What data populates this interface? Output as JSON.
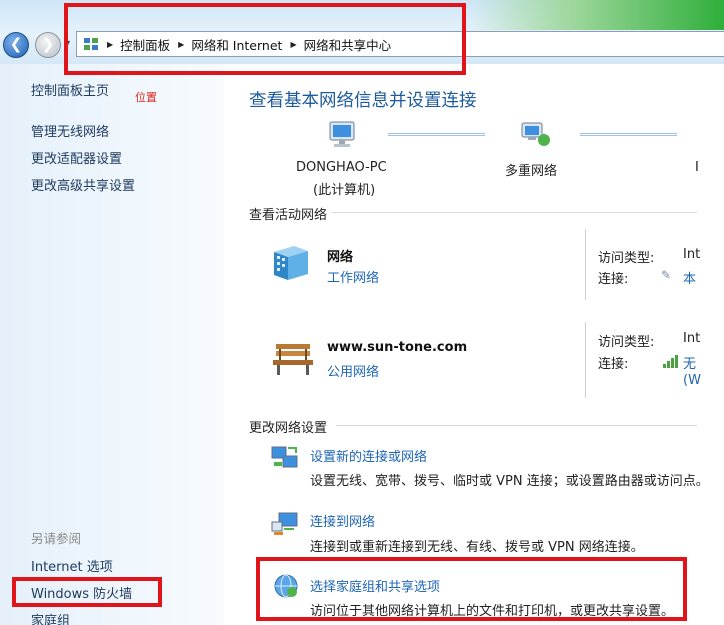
{
  "address_bar": {
    "crumbs": [
      "控制面板",
      "网络和 Internet",
      "网络和共享中心"
    ]
  },
  "left_pane": {
    "home": "控制面板主页",
    "location_note": "位置",
    "links": [
      "管理无线网络",
      "更改适配器设置",
      "更改高级共享设置"
    ],
    "see_also_title": "另请参阅",
    "see_also": [
      "Internet 选项",
      "Windows 防火墙",
      "家庭组"
    ]
  },
  "main": {
    "title": "查看基本网络信息并设置连接",
    "network_map": {
      "computer_name": "DONGHAO-PC",
      "computer_sub": "(此计算机)",
      "middle_label": "多重网络",
      "right_partial": "I"
    },
    "active_section": "查看活动网络",
    "networks": [
      {
        "name": "网络",
        "type": "工作网络",
        "access_label": "访问类型:",
        "access_value": "Int",
        "conn_label": "连接:",
        "conn_value": "本"
      },
      {
        "name": "www.sun-tone.com",
        "type": "公用网络",
        "access_label": "访问类型:",
        "access_value": "Int",
        "conn_label": "连接:",
        "conn_value": "无",
        "conn_value2": "(W"
      }
    ],
    "change_section": "更改网络设置",
    "tasks": [
      {
        "title": "设置新的连接或网络",
        "desc": "设置无线、宽带、拨号、临时或 VPN 连接；或设置路由器或访问点。"
      },
      {
        "title": "连接到网络",
        "desc": "连接到或重新连接到无线、有线、拨号或 VPN 网络连接。"
      },
      {
        "title": "选择家庭组和共享选项",
        "desc": "访问位于其他网络计算机上的文件和打印机，或更改共享设置。"
      }
    ]
  },
  "colors": {
    "link": "#1e66b5",
    "title": "#1e5b9e",
    "annotation_red": "#e0141b"
  }
}
